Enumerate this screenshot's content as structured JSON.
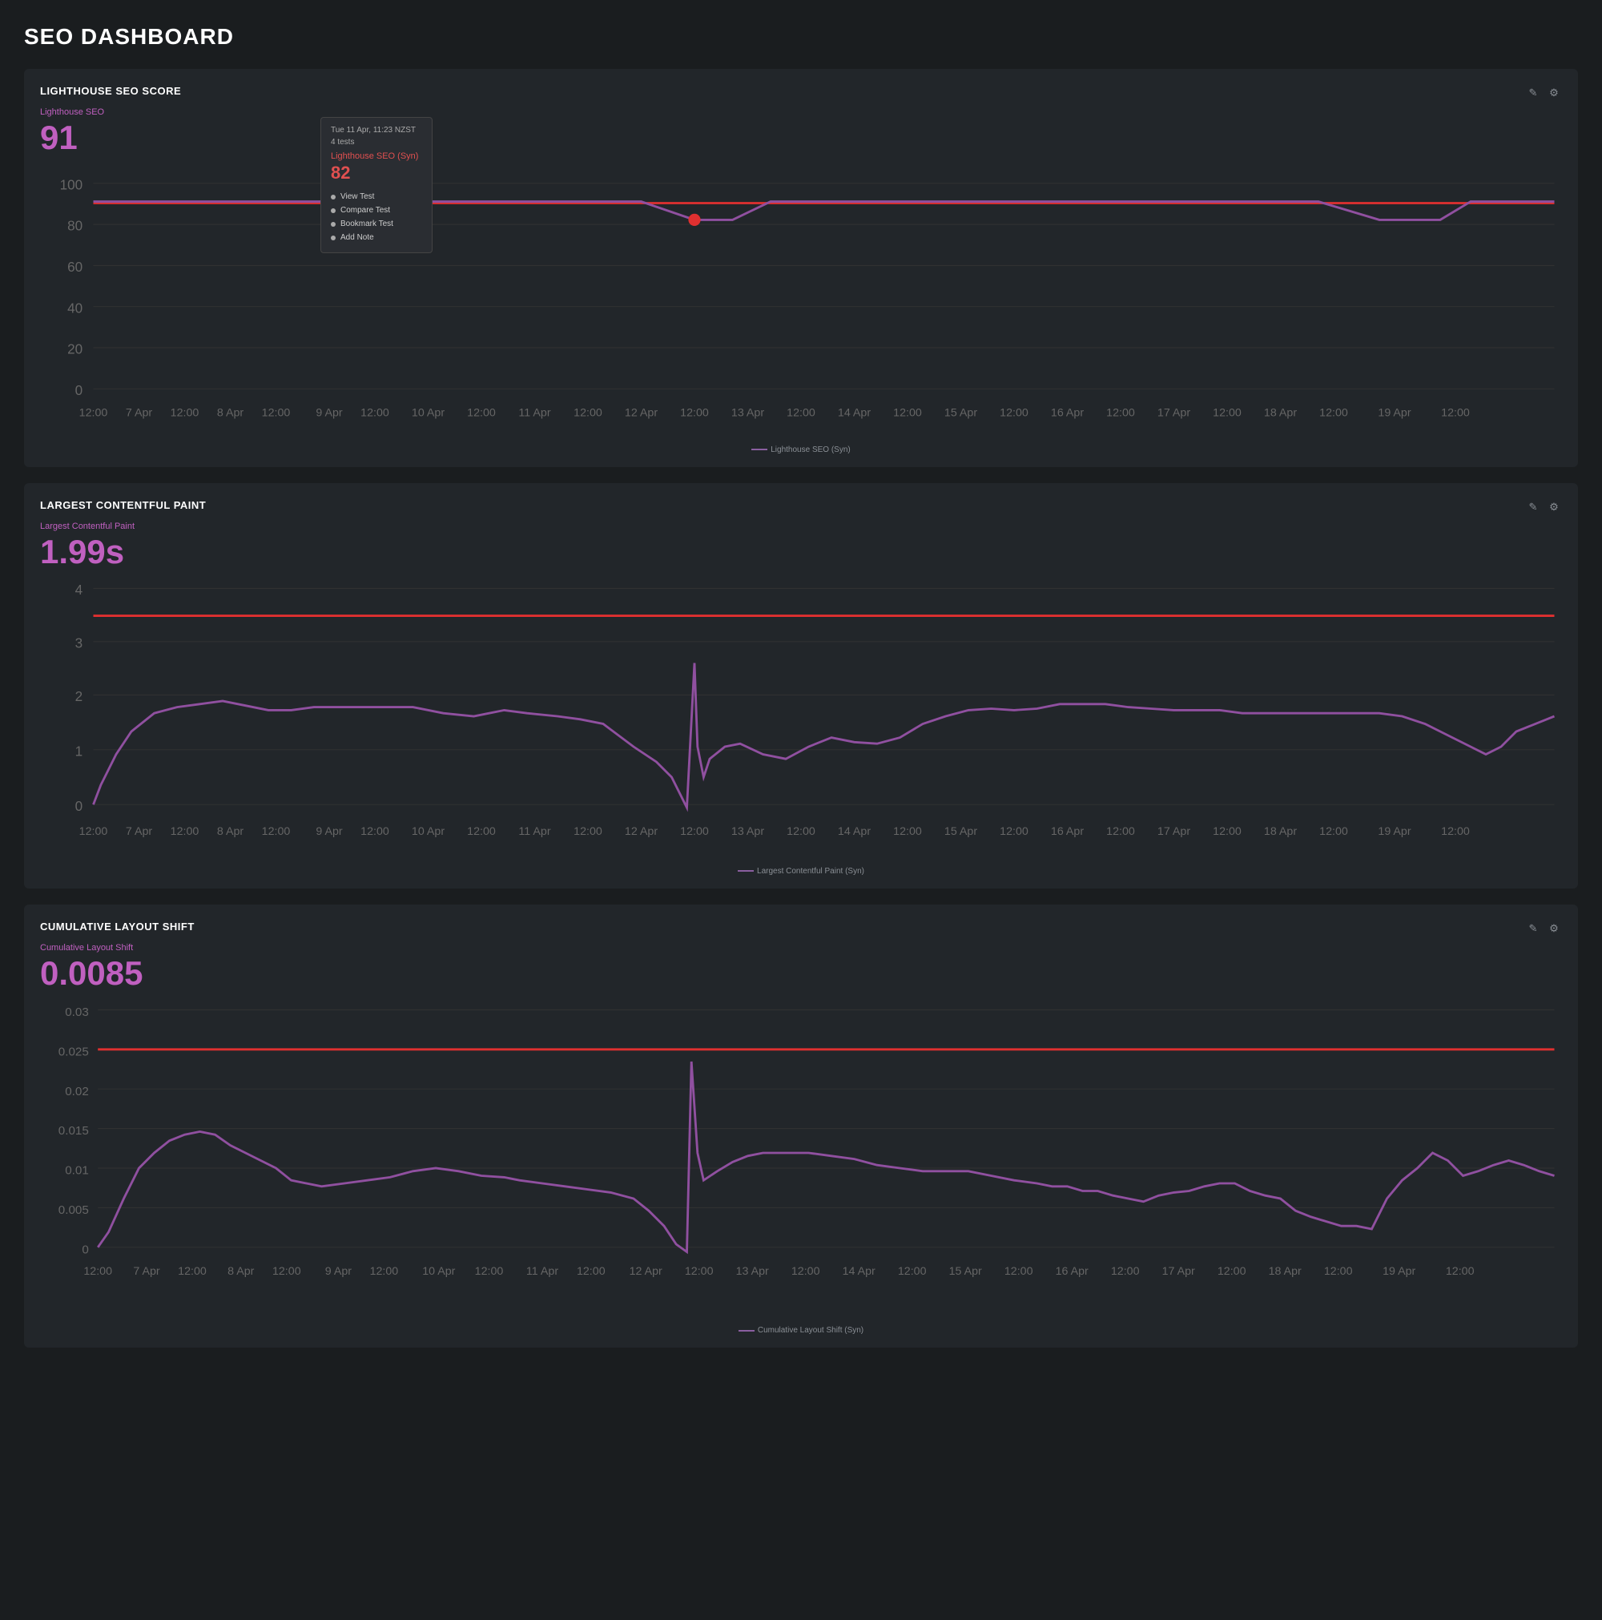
{
  "page": {
    "title": "SEO DASHBOARD"
  },
  "panels": {
    "lighthouse": {
      "title": "LIGHTHOUSE SEO SCORE",
      "metric_label": "Lighthouse SEO",
      "metric_value": "91",
      "legend_label": "Lighthouse SEO (Syn)",
      "edit_icon": "✎",
      "settings_icon": "⚙",
      "y_labels": [
        "100",
        "80",
        "60",
        "40",
        "20",
        "0"
      ],
      "x_labels": [
        "12:00",
        "7 Apr",
        "12:00",
        "8 Apr",
        "12:00",
        "9 Apr",
        "12:00",
        "10 Apr",
        "12:00",
        "11 Apr",
        "12:00",
        "12 Apr",
        "12:00",
        "13 Apr",
        "12:00",
        "14 Apr",
        "12:00",
        "15 Apr",
        "12:00",
        "16 Apr",
        "12:00",
        "17 Apr",
        "12:00",
        "18 Apr",
        "12:00",
        "19 Apr",
        "12:00"
      ]
    },
    "lcp": {
      "title": "LARGEST CONTENTFUL PAINT",
      "metric_label": "Largest Contentful Paint",
      "metric_value": "1.99s",
      "legend_label": "Largest Contentful Paint (Syn)",
      "edit_icon": "✎",
      "settings_icon": "⚙",
      "y_labels": [
        "4",
        "3",
        "2",
        "1",
        "0"
      ]
    },
    "cls": {
      "title": "CUMULATIVE LAYOUT SHIFT",
      "metric_label": "Cumulative Layout Shift",
      "metric_value": "0.0085",
      "legend_label": "Cumulative Layout Shift (Syn)",
      "edit_icon": "✎",
      "settings_icon": "⚙",
      "y_labels": [
        "0.03",
        "0.025",
        "0.02",
        "0.015",
        "0.01",
        "0.005",
        "0"
      ]
    }
  },
  "tooltip": {
    "date": "Tue 11 Apr, 11:23 NZST",
    "tests": "4 tests",
    "metric_name": "Lighthouse SEO (Syn)",
    "metric_value": "82",
    "actions": [
      {
        "label": "View Test",
        "icon": "▶"
      },
      {
        "label": "Compare Test",
        "icon": "⊟"
      },
      {
        "label": "Bookmark Test",
        "icon": "⊠"
      },
      {
        "label": "Add Note",
        "icon": "✎"
      }
    ]
  },
  "colors": {
    "purple": "#c060c0",
    "red_line": "#e03030",
    "panel_bg": "#22262a",
    "chart_line": "#9050a0",
    "axis_color": "#444",
    "text_dim": "#666",
    "tooltip_red": "#e05050"
  }
}
